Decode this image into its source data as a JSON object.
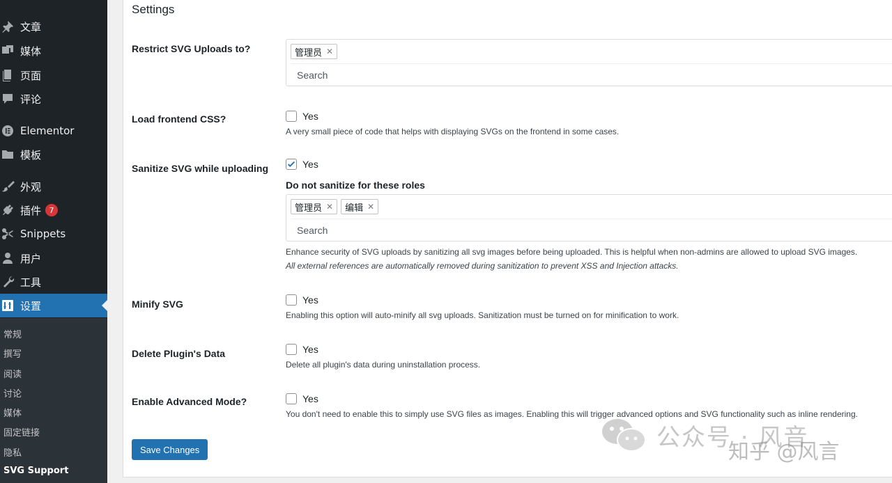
{
  "sidebar": {
    "items": [
      {
        "label": "文章",
        "icon": "pin-icon"
      },
      {
        "label": "媒体",
        "icon": "media-icon"
      },
      {
        "label": "页面",
        "icon": "page-icon"
      },
      {
        "label": "评论",
        "icon": "comment-icon"
      },
      {
        "label": "Elementor",
        "icon": "elementor-icon"
      },
      {
        "label": "模板",
        "icon": "folder-icon"
      },
      {
        "label": "外观",
        "icon": "brush-icon"
      },
      {
        "label": "插件",
        "icon": "plugin-icon",
        "badge": "7"
      },
      {
        "label": "Snippets",
        "icon": "scissors-icon"
      },
      {
        "label": "用户",
        "icon": "user-icon"
      },
      {
        "label": "工具",
        "icon": "wrench-icon"
      },
      {
        "label": "设置",
        "icon": "settings-icon",
        "active": true
      }
    ],
    "submenu": [
      "常规",
      "撰写",
      "阅读",
      "讨论",
      "媒体",
      "固定链接",
      "隐私",
      "SVG Support"
    ]
  },
  "main": {
    "title": "Settings",
    "restrict": {
      "label": "Restrict SVG Uploads to?",
      "tags": [
        "管理员"
      ],
      "search_placeholder": "Search"
    },
    "frontend_css": {
      "label": "Load frontend CSS?",
      "checkbox_label": "Yes",
      "checked": false,
      "description": "A very small piece of code that helps with displaying SVGs on the frontend in some cases."
    },
    "sanitize": {
      "label": "Sanitize SVG while uploading",
      "checkbox_label": "Yes",
      "checked": true,
      "sub_heading": "Do not sanitize for these roles",
      "tags": [
        "管理员",
        "编辑"
      ],
      "search_placeholder": "Search",
      "description": "Enhance security of SVG uploads by sanitizing all svg images before being uploaded. This is helpful when non-admins are allowed to upload SVG images.",
      "note": "All external references are automatically removed during sanitization to prevent XSS and Injection attacks."
    },
    "minify": {
      "label": "Minify SVG",
      "checkbox_label": "Yes",
      "checked": false,
      "description": "Enabling this option will auto-minify all svg uploads. Sanitization must be turned on for minification to work."
    },
    "delete_data": {
      "label": "Delete Plugin's Data",
      "checkbox_label": "Yes",
      "checked": false,
      "description": "Delete all plugin's data during uninstallation process."
    },
    "advanced": {
      "label": "Enable Advanced Mode?",
      "checkbox_label": "Yes",
      "checked": false,
      "description": "You don't need to enable this to simply use SVG files as images. Enabling this will trigger advanced options and SVG functionality such as inline rendering."
    },
    "save_label": "Save Changes"
  },
  "watermark": {
    "text": "公众号 · 风音",
    "text2": "知乎 @风言"
  },
  "colors": {
    "sidebar_bg": "#1d2327",
    "accent": "#2271b1",
    "badge": "#d63638"
  }
}
